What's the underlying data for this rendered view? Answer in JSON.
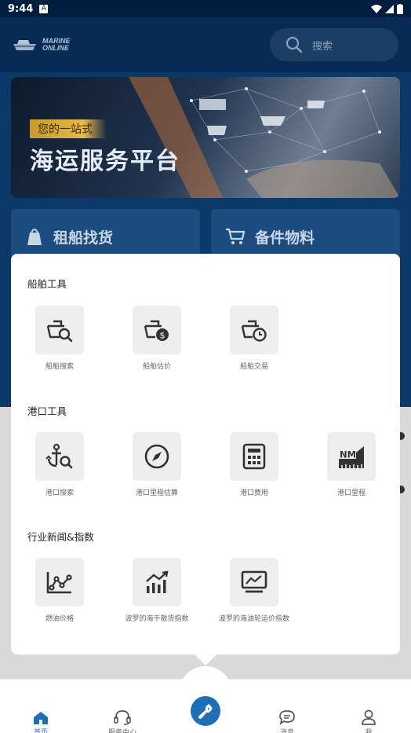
{
  "status_bar": {
    "time": "9:44"
  },
  "header": {
    "logo_line1": "MARINE",
    "logo_line2": "ONLINE",
    "search_placeholder": "搜索"
  },
  "banner": {
    "subtitle": "您的一站式",
    "title": "海运服务平台"
  },
  "cards": [
    {
      "label": "租船找货"
    },
    {
      "label": "备件物料"
    }
  ],
  "sheet": {
    "sections": [
      {
        "title": "船舶工具",
        "tools": [
          {
            "label": "船舶搜索",
            "icon": "ship-search-icon"
          },
          {
            "label": "船舶估价",
            "icon": "ship-valuation-icon"
          },
          {
            "label": "船舶交易",
            "icon": "ship-trade-icon"
          }
        ]
      },
      {
        "title": "港口工具",
        "tools": [
          {
            "label": "港口搜索",
            "icon": "anchor-search-icon"
          },
          {
            "label": "港口里程估算",
            "icon": "compass-icon"
          },
          {
            "label": "港口费用",
            "icon": "calculator-icon"
          },
          {
            "label": "港口里程",
            "icon": "nautical-mile-icon",
            "icon_text": "NM"
          }
        ]
      },
      {
        "title": "行业新闻&指数",
        "tools": [
          {
            "label": "燃油价格",
            "icon": "line-chart-icon"
          },
          {
            "label": "波罗的海干散货指数",
            "icon": "bar-trend-icon"
          },
          {
            "label": "波罗的海油轮运价指数",
            "icon": "monitor-chart-icon"
          }
        ]
      }
    ]
  },
  "tabbar": {
    "tabs": [
      {
        "label": "首页",
        "icon": "home-icon",
        "active": true
      },
      {
        "label": "服务中心",
        "icon": "headset-icon",
        "active": false
      },
      {
        "label": "",
        "icon": "wrench-icon",
        "active": false
      },
      {
        "label": "消息",
        "icon": "message-icon",
        "active": false
      },
      {
        "label": "我",
        "icon": "person-icon",
        "active": false
      }
    ]
  },
  "colors": {
    "accent": "#1f6fb7",
    "header_bg": "#072b55",
    "banner_gold": "#e6b94b"
  }
}
